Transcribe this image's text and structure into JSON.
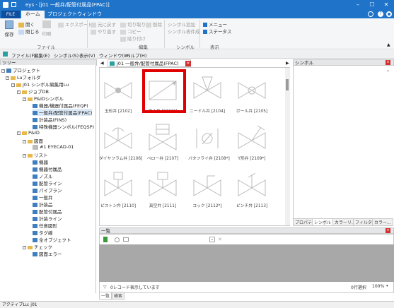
{
  "window": {
    "title": "eys - [j01 一般弁/配管付属品(FPAC)]",
    "app_tab": "FILE"
  },
  "ribbon": {
    "tabs": [
      "ホーム",
      "プロジェクト",
      "ウィンドウ"
    ],
    "save": "保存",
    "open": "開く",
    "close": "閉じる",
    "print": "印刷",
    "export": "エクスポート",
    "group_file": "ファイル",
    "undo": "元に戻す",
    "redo": "やり直す",
    "cut": "切り取り",
    "copy": "コピー",
    "paste": "貼り付け",
    "delete": "削除",
    "group_edit": "編集",
    "sym_check": "シンボル追加",
    "sym_conditions": "シンボル表件成",
    "group_symbol": "シンボル",
    "menu": "メニュー",
    "status": "ステータス",
    "group_view": "表示"
  },
  "menubar": [
    "ファイル(F)",
    "編集(E)",
    "シンボル(S)",
    "表示(V)",
    "ウィンドウ(W)",
    "ヘルプ(H)"
  ],
  "tree": {
    "header": "ツリー",
    "items": [
      "プロジェクト",
      "Luフォルダ",
      "j01 シンボル編集用Lu",
      "ジョブDB",
      "P&IDシンボル",
      "機器/機器付属品(FEQP)",
      "一般弁/配管付属品(FPAC)",
      "計装品(FINS)",
      "特殊機器シンボル(FEQSP)",
      "P&ID",
      "図面",
      "#1 EYECAD-01",
      "リスト",
      "機器",
      "機器付属品",
      "ノズル",
      "配管ライン",
      "パイプラン",
      "一般弁",
      "計装品",
      "配管付属品",
      "計装ライン",
      "任意図形",
      "タグ線",
      "全オブジェクト",
      "チェック",
      "図面エラー"
    ]
  },
  "doc": {
    "tab": "j01 一般弁/配管付属品(FPAC)"
  },
  "symbols": [
    {
      "label": "玉形弁 [2102]"
    },
    {
      "label": "逆止弁 [2103*]"
    },
    {
      "label": "ニードル弁 [2104]"
    },
    {
      "label": "ボール弁 [2105]"
    },
    {
      "label": "ダイヤフラム弁 [2106]"
    },
    {
      "label": "ベロー弁 [2107]"
    },
    {
      "label": "バタフライ弁 [2108*]"
    },
    {
      "label": "Y形弁 [2109*]"
    },
    {
      "label": "ピストン弁 [2110]"
    },
    {
      "label": "真空弁 [2111]"
    },
    {
      "label": "コック [2112*]"
    },
    {
      "label": "ピンチ弁 [2113]"
    }
  ],
  "right_panel": {
    "header": "シンボル",
    "tabs": [
      "プロパティ",
      "シンボル",
      "カラーリ...",
      "フィルター",
      "カラー..."
    ]
  },
  "bottom": {
    "header": "一覧",
    "status": "0レコード表示しています",
    "count": "0行選択",
    "zoom": "100%",
    "tabs": [
      "一覧",
      "検索"
    ]
  },
  "statusbar": {
    "text": "アクティブLu: j01"
  },
  "colors": {
    "accent": "#1f73c8",
    "highlight": "#e00000"
  }
}
